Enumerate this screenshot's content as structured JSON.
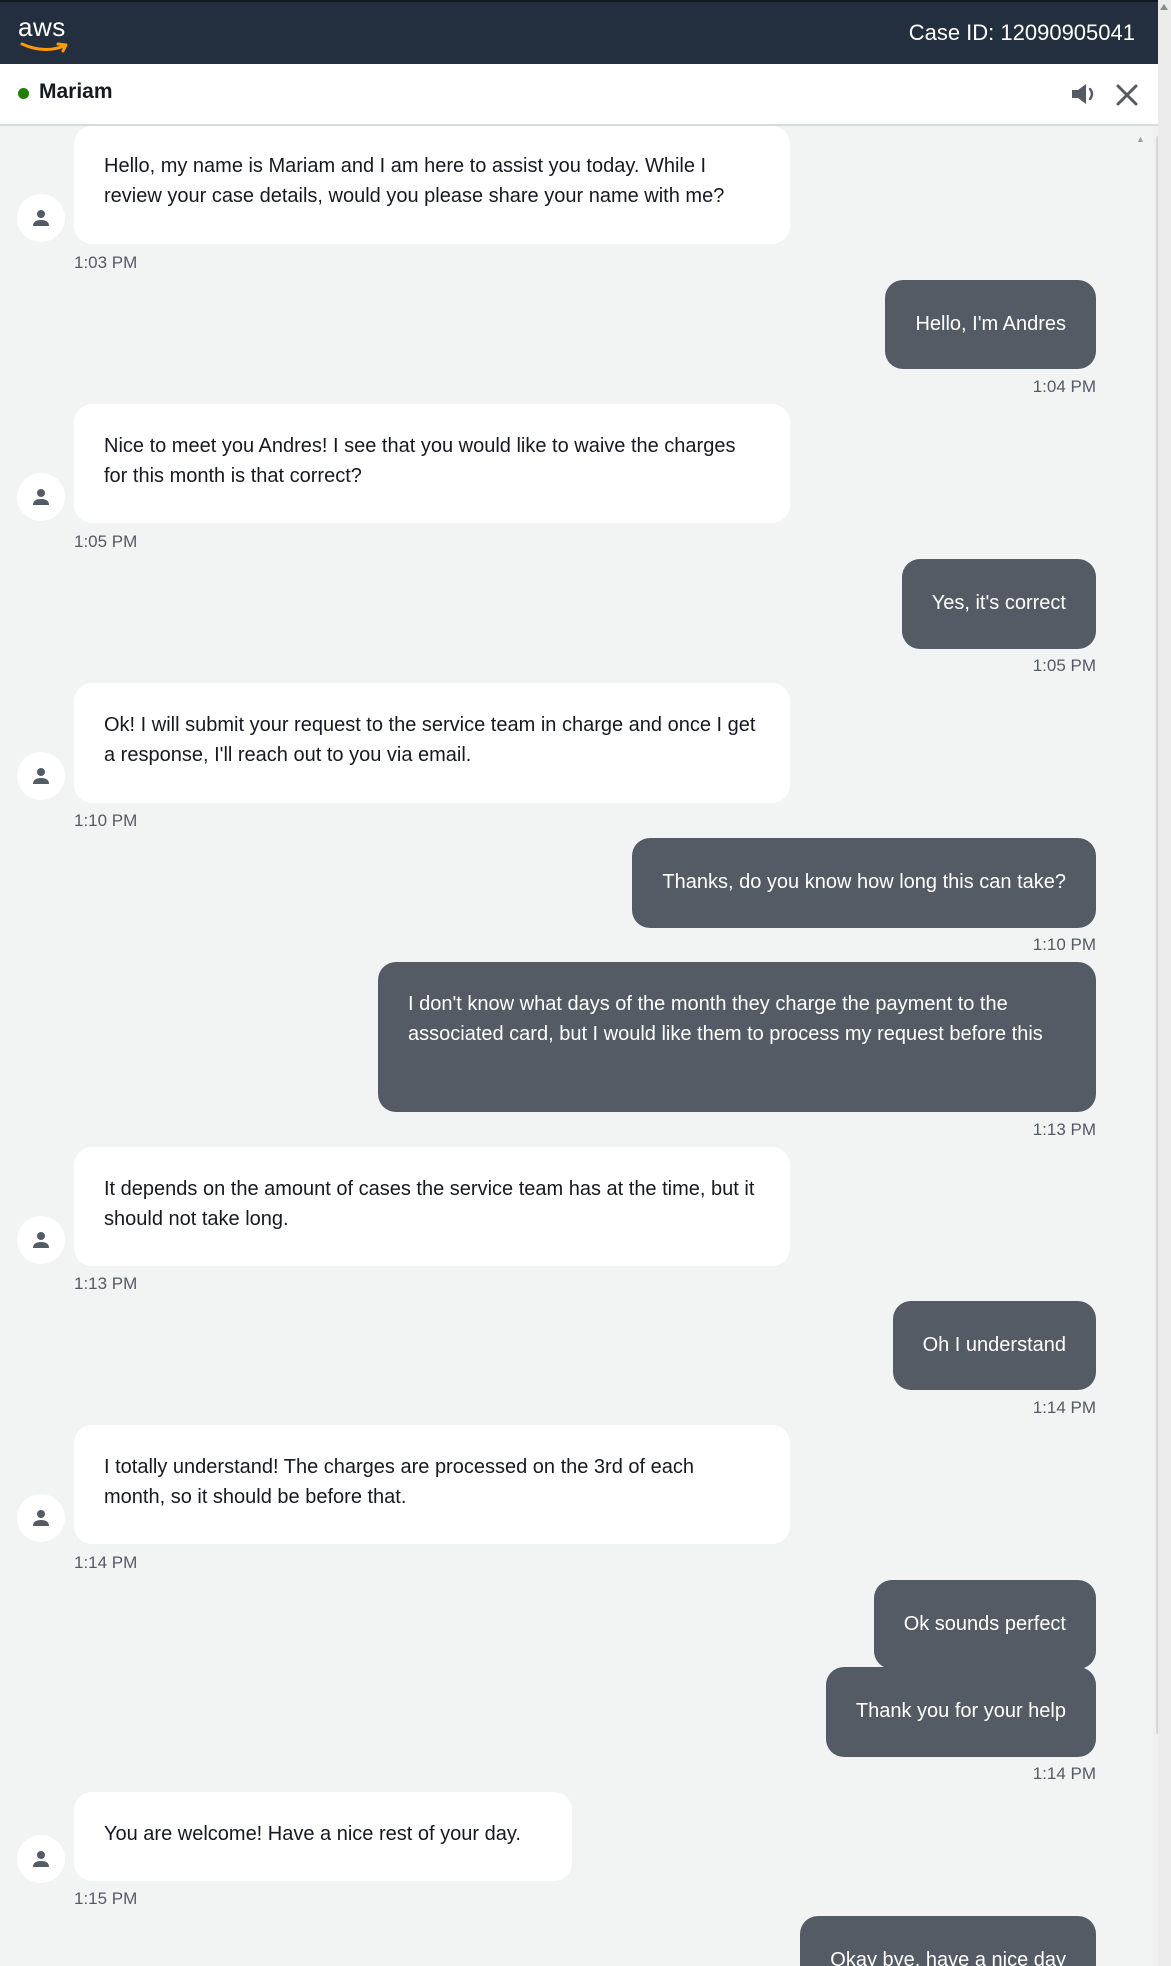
{
  "header": {
    "logo_text": "aws",
    "case_id": "Case ID: 12090905041"
  },
  "agent": {
    "name": "Mariam",
    "status_color": "#1d8102"
  },
  "colors": {
    "topbar": "#232f3e",
    "customer_bubble": "#545b64",
    "agent_bubble": "#ffffff",
    "background": "#f2f3f3"
  },
  "messages": [
    {
      "sender": "agent",
      "text": "Hello, my name is Mariam and I am here to assist you today. While I review your case details, would you please share your name with me?",
      "time": "1:03 PM"
    },
    {
      "sender": "customer",
      "text": "Hello, I'm Andres",
      "time": "1:04 PM"
    },
    {
      "sender": "agent",
      "text": "Nice to meet you Andres! I see that you would like to waive the charges for this month is that correct?",
      "time": "1:05 PM"
    },
    {
      "sender": "customer",
      "text": "Yes, it's correct",
      "time": "1:05 PM"
    },
    {
      "sender": "agent",
      "text": "Ok! I will submit your request to the service team in charge and once I get a response, I'll reach out to you via email.",
      "time": "1:10 PM"
    },
    {
      "sender": "customer",
      "text": "Thanks, do you know how long this can take?",
      "time": "1:10 PM"
    },
    {
      "sender": "customer",
      "text": "I don't know what days of the month they charge the payment to the associated card, but I would like them to process my request before this",
      "time": "1:13 PM"
    },
    {
      "sender": "agent",
      "text": "It depends on the amount of cases the service team has at the time, but it should not take long.",
      "time": "1:13 PM"
    },
    {
      "sender": "customer",
      "text": "Oh I understand",
      "time": "1:14 PM"
    },
    {
      "sender": "agent",
      "text": "I totally understand! The charges are processed on the 3rd of each month, so it should be before that.",
      "time": "1:14 PM"
    },
    {
      "sender": "customer",
      "text": "Ok sounds perfect",
      "time": ""
    },
    {
      "sender": "customer",
      "text": "Thank you for your help",
      "time": "1:14 PM"
    },
    {
      "sender": "agent",
      "text": "You are welcome! Have a nice rest of your day.",
      "time": "1:15 PM"
    },
    {
      "sender": "customer",
      "text": "Okay bye, have a nice day",
      "time": ""
    }
  ]
}
